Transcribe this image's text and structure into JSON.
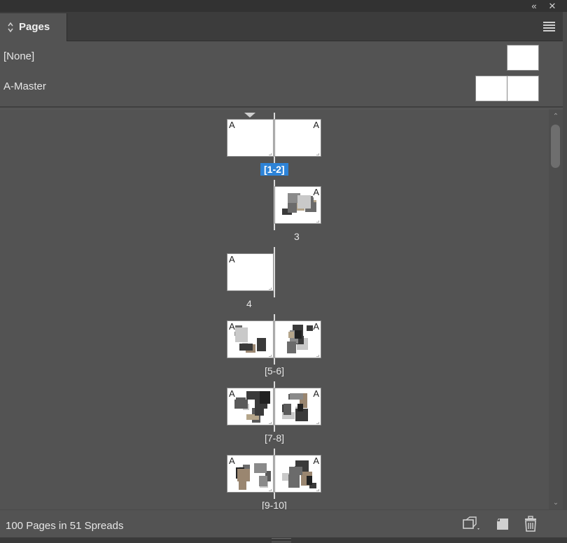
{
  "window": {
    "collapse_icon": "double-chevron-left-icon",
    "close_icon": "close-icon"
  },
  "panel": {
    "tab_label": "Pages",
    "tab_icon": "up-down-arrows-icon",
    "menu_icon": "hamburger-menu-icon"
  },
  "masters": [
    {
      "name": "[None]",
      "pages": 1
    },
    {
      "name": "A-Master",
      "pages": 2
    }
  ],
  "spreads": [
    {
      "label": "[1-2]",
      "selected": true,
      "pages": [
        {
          "side": "left",
          "prefix": "A",
          "images": false
        },
        {
          "side": "right",
          "prefix": "A",
          "images": false
        }
      ]
    },
    {
      "label": "3",
      "selected": false,
      "pages": [
        {
          "side": "right",
          "prefix": "A",
          "images": true
        }
      ]
    },
    {
      "label": "4",
      "selected": false,
      "pages": [
        {
          "side": "left",
          "prefix": "A",
          "images": false
        }
      ]
    },
    {
      "label": "[5-6]",
      "selected": false,
      "pages": [
        {
          "side": "left",
          "prefix": "A",
          "images": true
        },
        {
          "side": "right",
          "prefix": "A",
          "images": true
        }
      ]
    },
    {
      "label": "[7-8]",
      "selected": false,
      "pages": [
        {
          "side": "left",
          "prefix": "A",
          "images": true
        },
        {
          "side": "right",
          "prefix": "A",
          "images": true
        }
      ]
    },
    {
      "label": "[9-10]",
      "selected": false,
      "pages": [
        {
          "side": "left",
          "prefix": "A",
          "images": true
        },
        {
          "side": "right",
          "prefix": "A",
          "images": true
        }
      ]
    }
  ],
  "status": {
    "summary": "100 Pages in 51 Spreads",
    "edit_page_size_icon": "page-size-dropdown-icon",
    "new_page_icon": "new-page-icon",
    "delete_icon": "trash-icon"
  },
  "colors": {
    "panel_bg": "#535353",
    "selection": "#2d83d7"
  }
}
